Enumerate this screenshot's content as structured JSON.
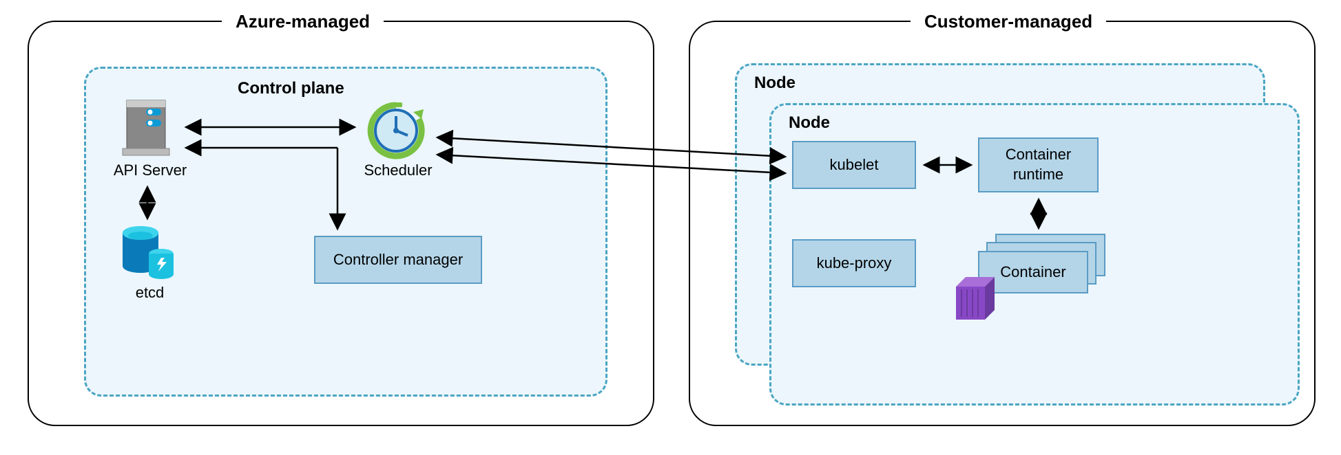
{
  "diagram": {
    "left_panel_title": "Azure-managed",
    "right_panel_title": "Customer-managed",
    "control_plane_title": "Control plane",
    "node_back_title": "Node",
    "node_front_title": "Node",
    "components": {
      "api_server": "API Server",
      "scheduler": "Scheduler",
      "etcd": "etcd",
      "controller_manager": "Controller manager",
      "kubelet": "kubelet",
      "kube_proxy": "kube-proxy",
      "container_runtime": "Container\nruntime",
      "container": "Container"
    }
  }
}
